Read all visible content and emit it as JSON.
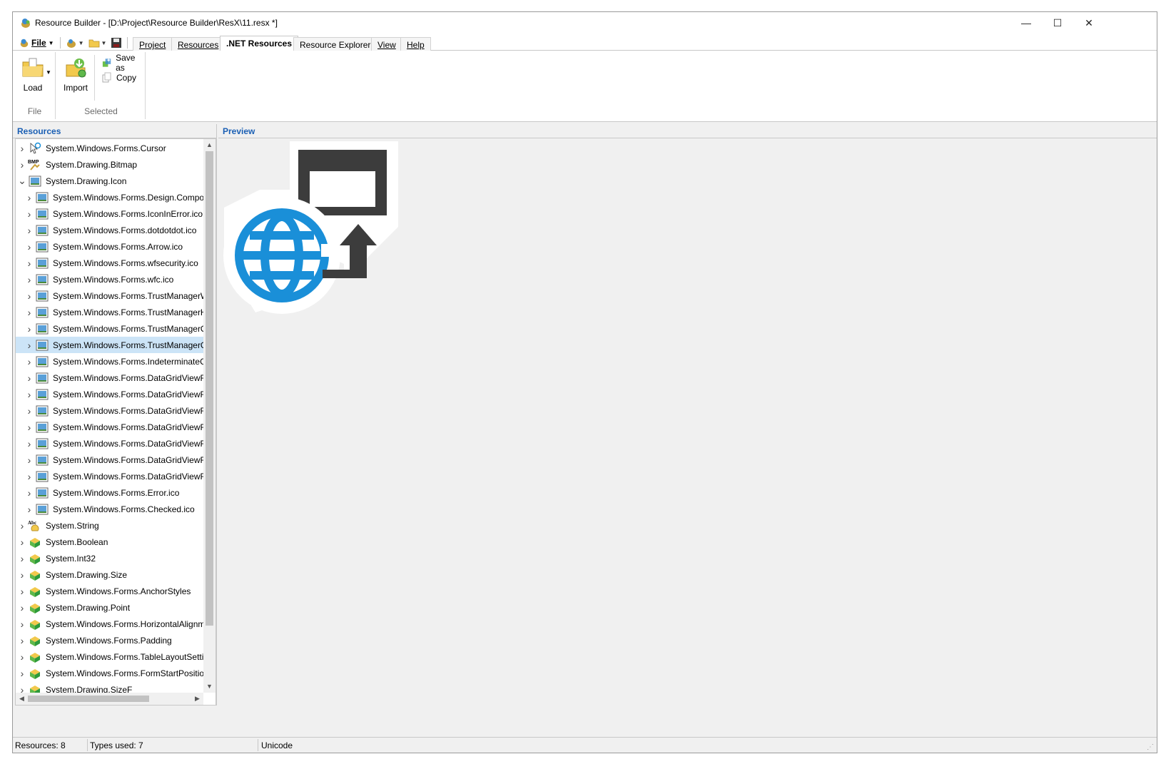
{
  "window": {
    "title": "Resource Builder - [D:\\Project\\Resource Builder\\ResX\\11.resx *]",
    "controls": {
      "minimize": "—",
      "maximize": "☐",
      "close": "✕"
    }
  },
  "qat": {
    "file_label": "File"
  },
  "tabs": [
    {
      "label": "Project",
      "active": false
    },
    {
      "label": "Resources",
      "active": false
    },
    {
      "label": ".NET Resources",
      "active": true
    },
    {
      "label": "Resource Explorer",
      "active": false
    },
    {
      "label": "View",
      "active": false
    },
    {
      "label": "Help",
      "active": false
    }
  ],
  "ribbon": {
    "file_group": {
      "label": "File",
      "load_label": "Load"
    },
    "selected_group": {
      "label": "Selected",
      "import_label": "Import",
      "save_as_label": "Save as",
      "copy_label": "Copy"
    }
  },
  "panels": {
    "resources_title": "Resources",
    "preview_title": "Preview"
  },
  "tree": {
    "items": [
      {
        "label": "System.Windows.Forms.Cursor",
        "icon": "cursor-icon",
        "level": 0,
        "chevron": "right"
      },
      {
        "label": "System.Drawing.Bitmap",
        "icon": "bitmap-icon",
        "level": 0,
        "chevron": "right"
      },
      {
        "label": "System.Drawing.Icon",
        "icon": "icon-type-icon",
        "level": 0,
        "chevron": "down"
      },
      {
        "label": "System.Windows.Forms.Design.Compor",
        "icon": "image-file-icon",
        "level": 1,
        "chevron": "right"
      },
      {
        "label": "System.Windows.Forms.IconInError.ico",
        "icon": "image-file-icon",
        "level": 1,
        "chevron": "right"
      },
      {
        "label": "System.Windows.Forms.dotdotdot.ico",
        "icon": "image-file-icon",
        "level": 1,
        "chevron": "right"
      },
      {
        "label": "System.Windows.Forms.Arrow.ico",
        "icon": "image-file-icon",
        "level": 1,
        "chevron": "right"
      },
      {
        "label": "System.Windows.Forms.wfsecurity.ico",
        "icon": "image-file-icon",
        "level": 1,
        "chevron": "right"
      },
      {
        "label": "System.Windows.Forms.wfc.ico",
        "icon": "image-file-icon",
        "level": 1,
        "chevron": "right"
      },
      {
        "label": "System.Windows.Forms.TrustManagerW",
        "icon": "image-file-icon",
        "level": 1,
        "chevron": "right"
      },
      {
        "label": "System.Windows.Forms.TrustManagerHi",
        "icon": "image-file-icon",
        "level": 1,
        "chevron": "right"
      },
      {
        "label": "System.Windows.Forms.TrustManagerOl",
        "icon": "image-file-icon",
        "level": 1,
        "chevron": "right"
      },
      {
        "label": "System.Windows.Forms.TrustManagerGl",
        "icon": "image-file-icon",
        "level": 1,
        "chevron": "right",
        "selected": true
      },
      {
        "label": "System.Windows.Forms.IndeterminateC",
        "icon": "image-file-icon",
        "level": 1,
        "chevron": "right"
      },
      {
        "label": "System.Windows.Forms.DataGridViewRc",
        "icon": "image-file-icon",
        "level": 1,
        "chevron": "right"
      },
      {
        "label": "System.Windows.Forms.DataGridViewRc",
        "icon": "image-file-icon",
        "level": 1,
        "chevron": "right"
      },
      {
        "label": "System.Windows.Forms.DataGridViewRc",
        "icon": "image-file-icon",
        "level": 1,
        "chevron": "right"
      },
      {
        "label": "System.Windows.Forms.DataGridViewRc",
        "icon": "image-file-icon",
        "level": 1,
        "chevron": "right"
      },
      {
        "label": "System.Windows.Forms.DataGridViewRc",
        "icon": "image-file-icon",
        "level": 1,
        "chevron": "right"
      },
      {
        "label": "System.Windows.Forms.DataGridViewRc",
        "icon": "image-file-icon",
        "level": 1,
        "chevron": "right"
      },
      {
        "label": "System.Windows.Forms.DataGridViewRc",
        "icon": "image-file-icon",
        "level": 1,
        "chevron": "right"
      },
      {
        "label": "System.Windows.Forms.Error.ico",
        "icon": "image-file-icon",
        "level": 1,
        "chevron": "right"
      },
      {
        "label": "System.Windows.Forms.Checked.ico",
        "icon": "image-file-icon",
        "level": 1,
        "chevron": "right"
      },
      {
        "label": "System.String",
        "icon": "string-icon",
        "level": 0,
        "chevron": "right"
      },
      {
        "label": "System.Boolean",
        "icon": "object-icon",
        "level": 0,
        "chevron": "right"
      },
      {
        "label": "System.Int32",
        "icon": "object-icon",
        "level": 0,
        "chevron": "right"
      },
      {
        "label": "System.Drawing.Size",
        "icon": "object-icon",
        "level": 0,
        "chevron": "right"
      },
      {
        "label": "System.Windows.Forms.AnchorStyles",
        "icon": "object-icon",
        "level": 0,
        "chevron": "right"
      },
      {
        "label": "System.Drawing.Point",
        "icon": "object-icon",
        "level": 0,
        "chevron": "right"
      },
      {
        "label": "System.Windows.Forms.HorizontalAlignm",
        "icon": "object-icon",
        "level": 0,
        "chevron": "right"
      },
      {
        "label": "System.Windows.Forms.Padding",
        "icon": "object-icon",
        "level": 0,
        "chevron": "right"
      },
      {
        "label": "System.Windows.Forms.TableLayoutSettin",
        "icon": "object-icon",
        "level": 0,
        "chevron": "right"
      },
      {
        "label": "System.Windows.Forms.FormStartPosition",
        "icon": "object-icon",
        "level": 0,
        "chevron": "right"
      },
      {
        "label": "System.Drawing.SizeF",
        "icon": "object-icon",
        "level": 0,
        "chevron": "right"
      }
    ]
  },
  "preview": {
    "image_icon": "globe-remote-window-icon",
    "globe_color": "#1a8fd8",
    "window_color": "#3c3c3c"
  },
  "status": {
    "resources": "Resources: 8",
    "types_used": "Types used: 7",
    "encoding": "Unicode"
  },
  "colors": {
    "accent": "#1a5fb4",
    "selection": "#cce4f7"
  }
}
